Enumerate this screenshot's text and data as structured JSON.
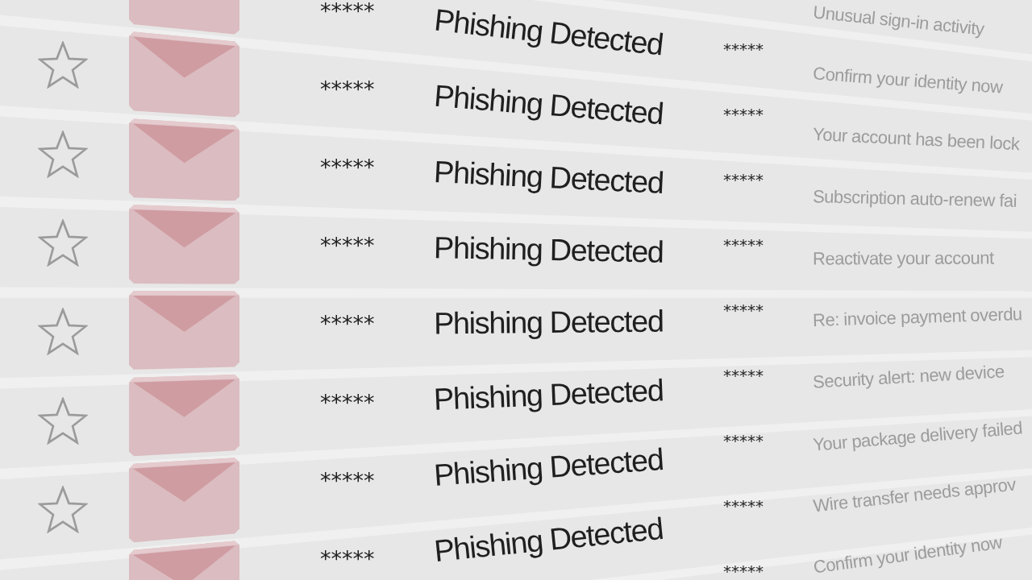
{
  "rows": [
    {
      "preview": "Unusual sign-in activity"
    },
    {
      "masked_1": "*****",
      "subject": "Phishing Detected",
      "masked_2": "*****",
      "preview": "Confirm your identity now"
    },
    {
      "starred": false,
      "masked_1": "*****",
      "subject": "Phishing Detected",
      "masked_2": "*****",
      "preview": "Your account has been lock"
    },
    {
      "starred": false,
      "masked_1": "*****",
      "subject": "Phishing Detected",
      "masked_2": "*****",
      "preview": "Subscription auto-renew fai"
    },
    {
      "starred": false,
      "masked_1": "*****",
      "subject": "Phishing Detected",
      "masked_2": "*****",
      "preview": "Reactivate your account"
    },
    {
      "starred": false,
      "masked_1": "*****",
      "subject": "Phishing Detected",
      "masked_2": "*****",
      "preview": "Re: invoice payment overdu"
    },
    {
      "starred": false,
      "masked_1": "*****",
      "subject": "Phishing Detected",
      "masked_2": "*****",
      "preview": "Security alert: new device"
    },
    {
      "starred": false,
      "masked_1": "*****",
      "subject": "Phishing Detected",
      "masked_2": "*****",
      "preview": "Your package delivery failed"
    },
    {
      "masked_1": "*****",
      "subject": "Phishing Detected",
      "masked_2": "*****",
      "preview": "Wire transfer needs approv"
    },
    {
      "masked_2": "*****",
      "preview": "Confirm your identity now"
    }
  ]
}
